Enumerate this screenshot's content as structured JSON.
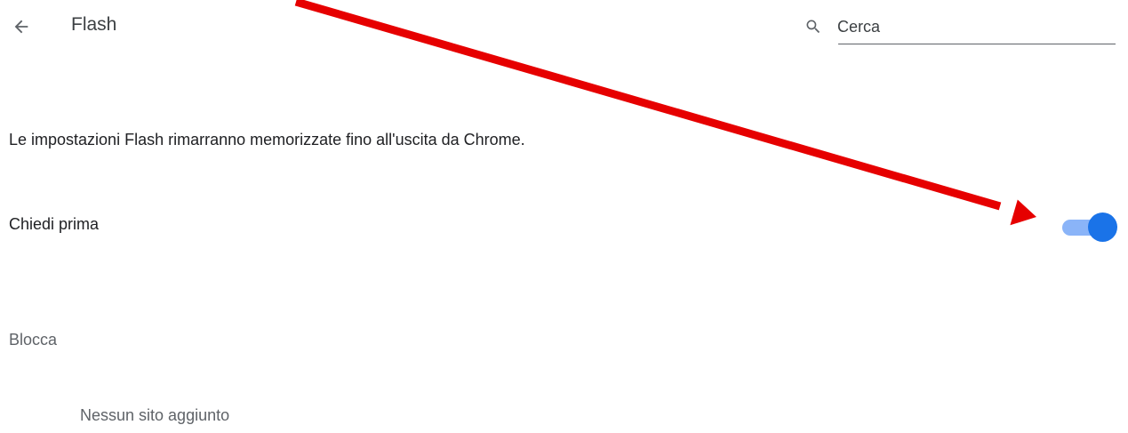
{
  "header": {
    "back_icon": "arrow-left-icon",
    "title": "Flash",
    "search": {
      "icon": "search-icon",
      "placeholder": "Cerca",
      "value": ""
    }
  },
  "description": "Le impostazioni Flash rimarranno memorizzate fino all'uscita da Chrome.",
  "ask_first": {
    "label": "Chiedi prima",
    "toggle_on": true,
    "toggle_colors": {
      "track": "#8ab4f8",
      "knob": "#1a73e8"
    }
  },
  "block_section": {
    "heading": "Blocca",
    "empty_message": "Nessun sito aggiunto"
  },
  "annotation": {
    "type": "arrow",
    "color": "#e60000"
  }
}
